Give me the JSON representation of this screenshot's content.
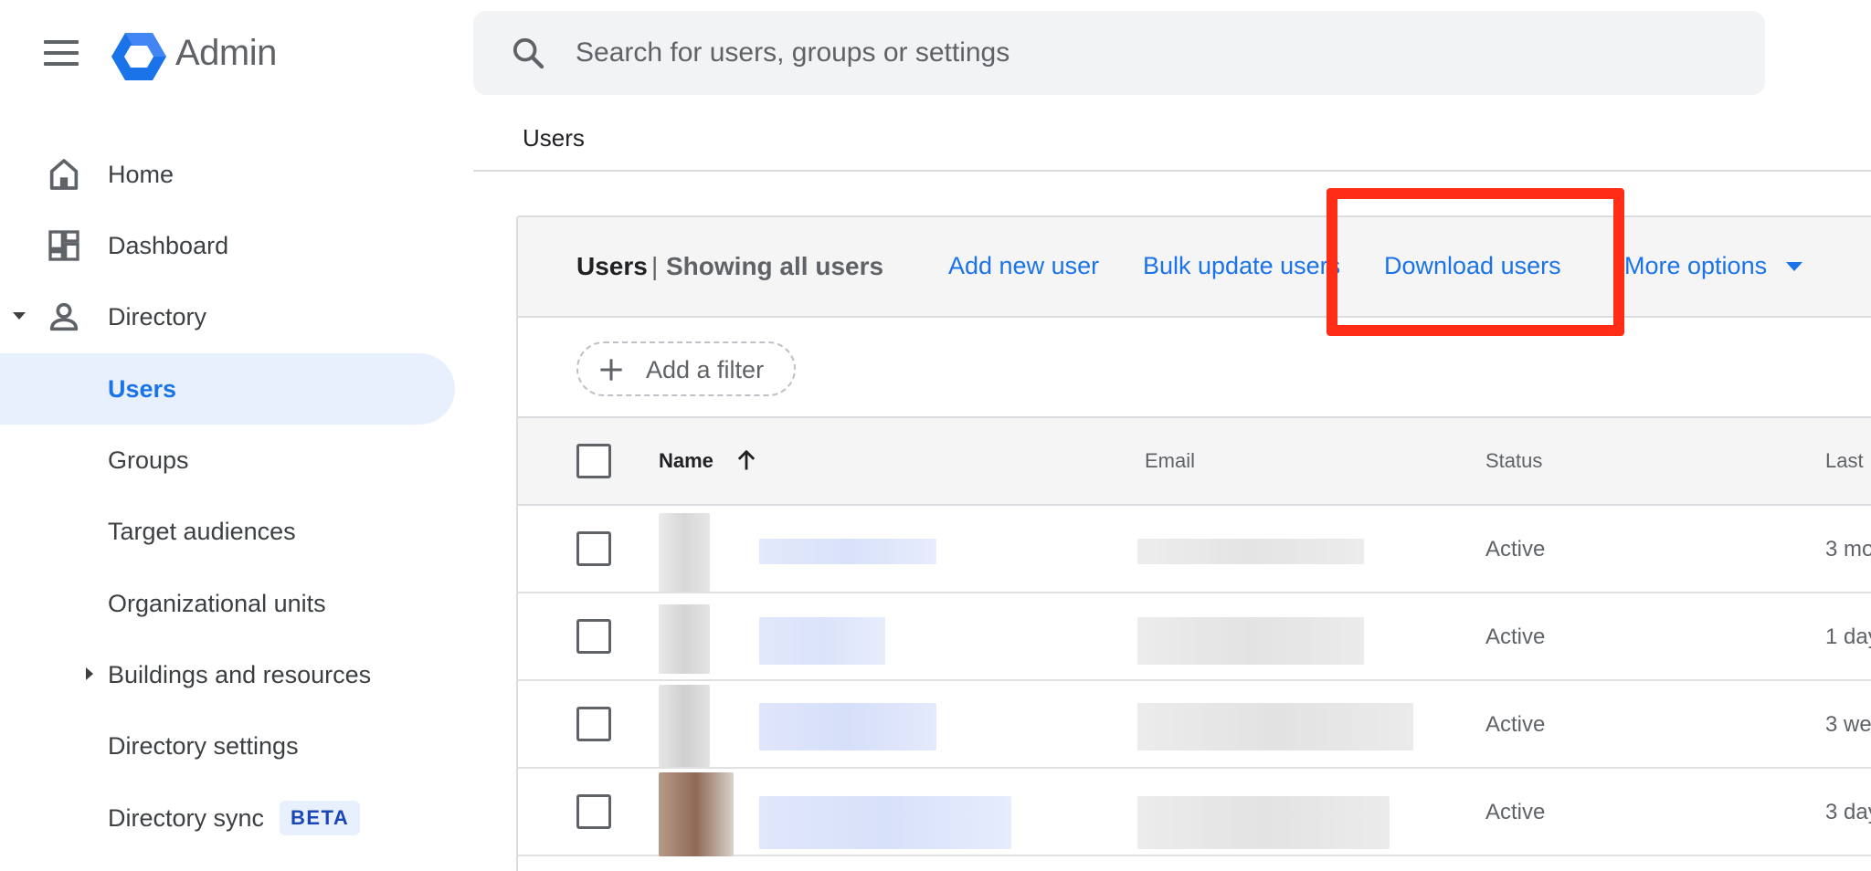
{
  "app": {
    "title": "Admin"
  },
  "search": {
    "placeholder": "Search for users, groups or settings"
  },
  "sidebar": {
    "items": [
      {
        "label": "Home"
      },
      {
        "label": "Dashboard"
      },
      {
        "label": "Directory"
      },
      {
        "label": "Users"
      },
      {
        "label": "Groups"
      },
      {
        "label": "Target audiences"
      },
      {
        "label": "Organizational units"
      },
      {
        "label": "Buildings and resources"
      },
      {
        "label": "Directory settings"
      },
      {
        "label": "Directory sync",
        "badge": "BETA"
      }
    ]
  },
  "breadcrumb": "Users",
  "header": {
    "title": "Users",
    "separator": "|",
    "subtitle": "Showing all users",
    "actions": [
      "Add new user",
      "Bulk update users",
      "Download users",
      "More options"
    ]
  },
  "filter": {
    "label": "Add a filter"
  },
  "table": {
    "columns": [
      "Name",
      "Email",
      "Status",
      "Last"
    ],
    "rows": [
      {
        "status": "Active",
        "last": "3 mo"
      },
      {
        "status": "Active",
        "last": "1 day"
      },
      {
        "status": "Active",
        "last": "3 we"
      },
      {
        "status": "Active",
        "last": "3 day"
      }
    ]
  },
  "colors": {
    "accent": "#1a73e8",
    "highlight": "#ff2d16",
    "active_nav_bg": "#e8f0fe"
  },
  "icons": [
    "menu-icon",
    "admin-logo",
    "search-icon",
    "home-icon",
    "dashboard-icon",
    "person-icon",
    "plus-icon",
    "arrow-up-icon"
  ]
}
